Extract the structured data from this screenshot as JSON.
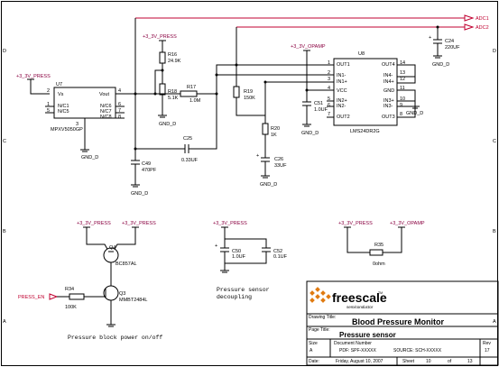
{
  "nets": {
    "adc1": "ADC1",
    "adc2": "ADC2",
    "press_en": "PRESS_EN",
    "v33_press": "+3_3V_PRESS",
    "v33_opamp": "+3_3V_OPAMP",
    "gnd": "GND_D"
  },
  "components": {
    "u7": {
      "ref": "U7",
      "part": "MPXV5050GP",
      "pins": [
        "Vs",
        "N/C1",
        "N/C5",
        "Vout",
        "N/C6",
        "N/C7",
        "N/C8"
      ],
      "pin_numbers": [
        "2",
        "1",
        "5",
        "4",
        "6",
        "7",
        "8",
        "3"
      ]
    },
    "u8": {
      "ref": "U8",
      "part": "LMS24DR2G",
      "pins_left": [
        "OUT1",
        "IN1-",
        "IN1+",
        "VCC",
        "IN2+",
        "IN2-",
        "OUT2"
      ],
      "pins_right": [
        "OUT4",
        "IN4-",
        "IN4+",
        "GND",
        "IN3+",
        "IN3-",
        "OUT3"
      ],
      "pin_numbers_left": [
        "1",
        "2",
        "3",
        "4",
        "5",
        "6",
        "7"
      ],
      "pin_numbers_right": [
        "14",
        "13",
        "12",
        "11",
        "10",
        "9",
        "8"
      ]
    },
    "r16": {
      "ref": "R16",
      "value": "24.9K"
    },
    "r18": {
      "ref": "R18",
      "value": "5.1K"
    },
    "r17": {
      "ref": "R17",
      "value": "1.0M"
    },
    "r19": {
      "ref": "R19",
      "value": "150K"
    },
    "r20": {
      "ref": "R20",
      "value": "1K"
    },
    "r34": {
      "ref": "R34",
      "value": "100K"
    },
    "r35": {
      "ref": "R35",
      "value": "0ohm"
    },
    "c25": {
      "ref": "C25",
      "value": "0.33UF"
    },
    "c24": {
      "ref": "C24",
      "value": "220UF"
    },
    "c51": {
      "ref": "C51",
      "value": "1.0UF"
    },
    "c26": {
      "ref": "C26",
      "value": "33UF"
    },
    "c49": {
      "ref": "C49",
      "value": "470PF"
    },
    "c50": {
      "ref": "C50",
      "value": "1.0UF"
    },
    "c52": {
      "ref": "C52",
      "value": "0.1UF"
    },
    "q4": {
      "ref": "Q4",
      "part": "BC857AL"
    },
    "q3": {
      "ref": "Q3",
      "part": "MMBT2484L"
    }
  },
  "notes": {
    "power_block": "Pressure block power on/off",
    "decoupling_1": "Pressure sensor",
    "decoupling_2": "decoupling"
  },
  "title_block": {
    "logo": "freescale",
    "logo_sub": "semiconductor",
    "tm": "TM",
    "drawing_title_label": "Drawing Title:",
    "drawing_title": "Blood Pressure Monitor",
    "page_title_label": "Page Title:",
    "page_title": "Pressure sensor",
    "size_label": "Size",
    "size": "A",
    "doc_label": "Document Number",
    "doc_number": "PDF: SPF-XXXXX",
    "doc_source": "SOURCE: SCH-XXXXX",
    "rev_label": "Rev",
    "rev": "17",
    "date_label": "Date:",
    "date": "Friday, August 10, 2007",
    "sheet_label": "Sheet",
    "sheet_num": "10",
    "of_label": "of",
    "sheet_total": "13"
  },
  "border_marks": {
    "left": [
      "D",
      "C",
      "B",
      "A"
    ],
    "right": [
      "D",
      "C",
      "B",
      "A"
    ]
  }
}
